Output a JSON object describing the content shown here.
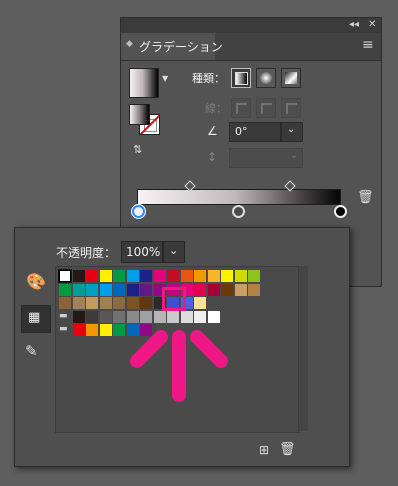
{
  "gradient_panel": {
    "title": "グラデーション",
    "collapse_glyph": "◂◂",
    "close_glyph": "✕",
    "type_label": "種類：",
    "stroke_label": "線：",
    "angle_value": "0°",
    "aspect_value": ""
  },
  "swatch_panel": {
    "opacity_label": "不透明度：",
    "opacity_value": "100%"
  },
  "swatch_rows": [
    [
      "#ffffff",
      "#231815",
      "#e60012",
      "#fff100",
      "#009944",
      "#00a0e9",
      "#1d2088",
      "#e4007f",
      "#c30d23",
      "#e95513",
      "#f39800",
      "#f8b62d",
      "#fff100",
      "#cfdb00",
      "#8fc31f"
    ],
    [
      "#009944",
      "#009e96",
      "#00a0c1",
      "#00a0e9",
      "#0068b7",
      "#1d2088",
      "#601986",
      "#920783",
      "#be0081",
      "#e4007f",
      "#e5004f",
      "#a40035",
      "#6a3906",
      "#c9a063",
      "#b28146"
    ],
    [
      "#8c6239",
      "#a2825e",
      "#c29a63",
      "#a0814f",
      "#8c6a3f",
      "#7e5426",
      "#603813",
      "#2a2a2a",
      "#3e4fd6",
      "#4a63e0",
      "#ffe09a"
    ],
    [
      "folder",
      "#231815",
      "#3e3a39",
      "#595757",
      "#727171",
      "#898989",
      "#9fa0a0",
      "#b5b5b6",
      "#c9caca",
      "#dcdddd",
      "#efefef",
      "#ffffff"
    ],
    [
      "folder",
      "#e60012",
      "#f39800",
      "#fff100",
      "#009944",
      "#0068b7",
      "#920783"
    ]
  ],
  "colors": {
    "accent_pink": "#ef1686",
    "panel_bg": "#535353",
    "selected_stop_ring": "#2b8cff"
  },
  "icons": {
    "palette": "palette-icon",
    "swatches": "swatches-icon",
    "eyedropper": "eyedropper-icon",
    "trash": "trash-icon",
    "new_swatch": "new-swatch-icon"
  }
}
